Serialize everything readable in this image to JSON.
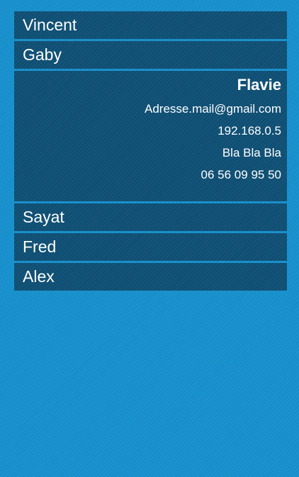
{
  "contacts": [
    {
      "name": "Vincent"
    },
    {
      "name": "Gaby"
    },
    {
      "name": "Flavie",
      "email": "Adresse.mail@gmail.com",
      "ip": "192.168.0.5",
      "note": "Bla Bla Bla",
      "phone": "06 56 09 95 50",
      "expanded": true
    },
    {
      "name": "Sayat"
    },
    {
      "name": "Fred"
    },
    {
      "name": "Alex"
    }
  ],
  "colors": {
    "background": "#168fcb",
    "item_background": "#0f4f74",
    "text": "#ffffff"
  }
}
